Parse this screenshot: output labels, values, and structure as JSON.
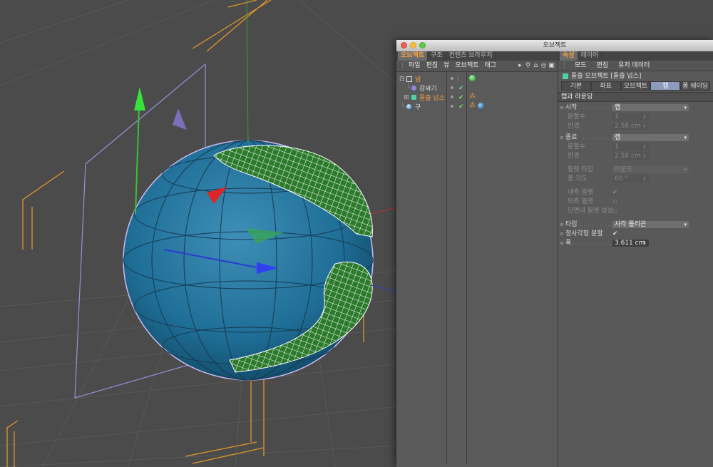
{
  "window": {
    "title": "오브젝트",
    "traffic_colors": [
      "#ec5f54",
      "#f5bd3a",
      "#5ec942"
    ]
  },
  "object_panel": {
    "tabs": [
      {
        "label": "오브젝트",
        "active": true
      },
      {
        "label": "구조",
        "active": false
      },
      {
        "label": "컨텐츠 브라우저",
        "active": false
      }
    ],
    "menu": [
      "파일",
      "편집",
      "뷰",
      "오브젝트",
      "태그"
    ],
    "tree": [
      {
        "name": "넘",
        "color": "#f0a040",
        "icon": "null-icon",
        "tag": "green-material-ball"
      },
      {
        "name": "감싸기",
        "color": "#dddddd",
        "icon": "wrap-deformer-icon",
        "tag": ""
      },
      {
        "name": "돌출 넙스",
        "color": "#f0a040",
        "icon": "extrude-nurbs-icon",
        "tag": "phong-tag"
      },
      {
        "name": "구",
        "color": "#dddddd",
        "icon": "sphere-icon",
        "tag": "blue-material-ball"
      }
    ]
  },
  "attributes": {
    "tabs": [
      {
        "label": "속성",
        "active": true
      },
      {
        "label": "레이어",
        "active": false
      }
    ],
    "menu": [
      "모드",
      "편집",
      "유저 데이터"
    ],
    "title": "돌출 오브젝트 [돌출 넙스]",
    "subtabs": [
      {
        "label": "기본",
        "active": false
      },
      {
        "label": "좌표",
        "active": false
      },
      {
        "label": "오브젝트",
        "active": false
      },
      {
        "label": "캡",
        "active": true
      },
      {
        "label": "퐁 쉐이딩",
        "active": false
      }
    ],
    "section": "캡과 라운딩",
    "start": {
      "label": "시작",
      "value": "캡"
    },
    "start_steps": {
      "label": "분할수",
      "value": "1"
    },
    "start_radius": {
      "label": "반경",
      "value": "2.58 cm"
    },
    "end": {
      "label": "종료",
      "value": "캡"
    },
    "end_steps": {
      "label": "분할수",
      "value": "1"
    },
    "end_radius": {
      "label": "반경",
      "value": "2.58 cm"
    },
    "fillet_type": {
      "label": "필렛 타입",
      "value": "어운드"
    },
    "phong_angle": {
      "label": "퐁 각도",
      "value": "60 °"
    },
    "hull_inwards": {
      "label": "내측 필렛",
      "checked": true
    },
    "hole_inwards": {
      "label": "외측 필렛",
      "checked": false
    },
    "constrain": {
      "label": "단면내 필렛 생성",
      "checked": false
    },
    "type": {
      "label": "타입",
      "value": "사각 폴리곤"
    },
    "regular_grid": {
      "label": "정사각형 분할",
      "checked": true
    },
    "width": {
      "label": "폭",
      "value": "3.611 cm"
    }
  }
}
